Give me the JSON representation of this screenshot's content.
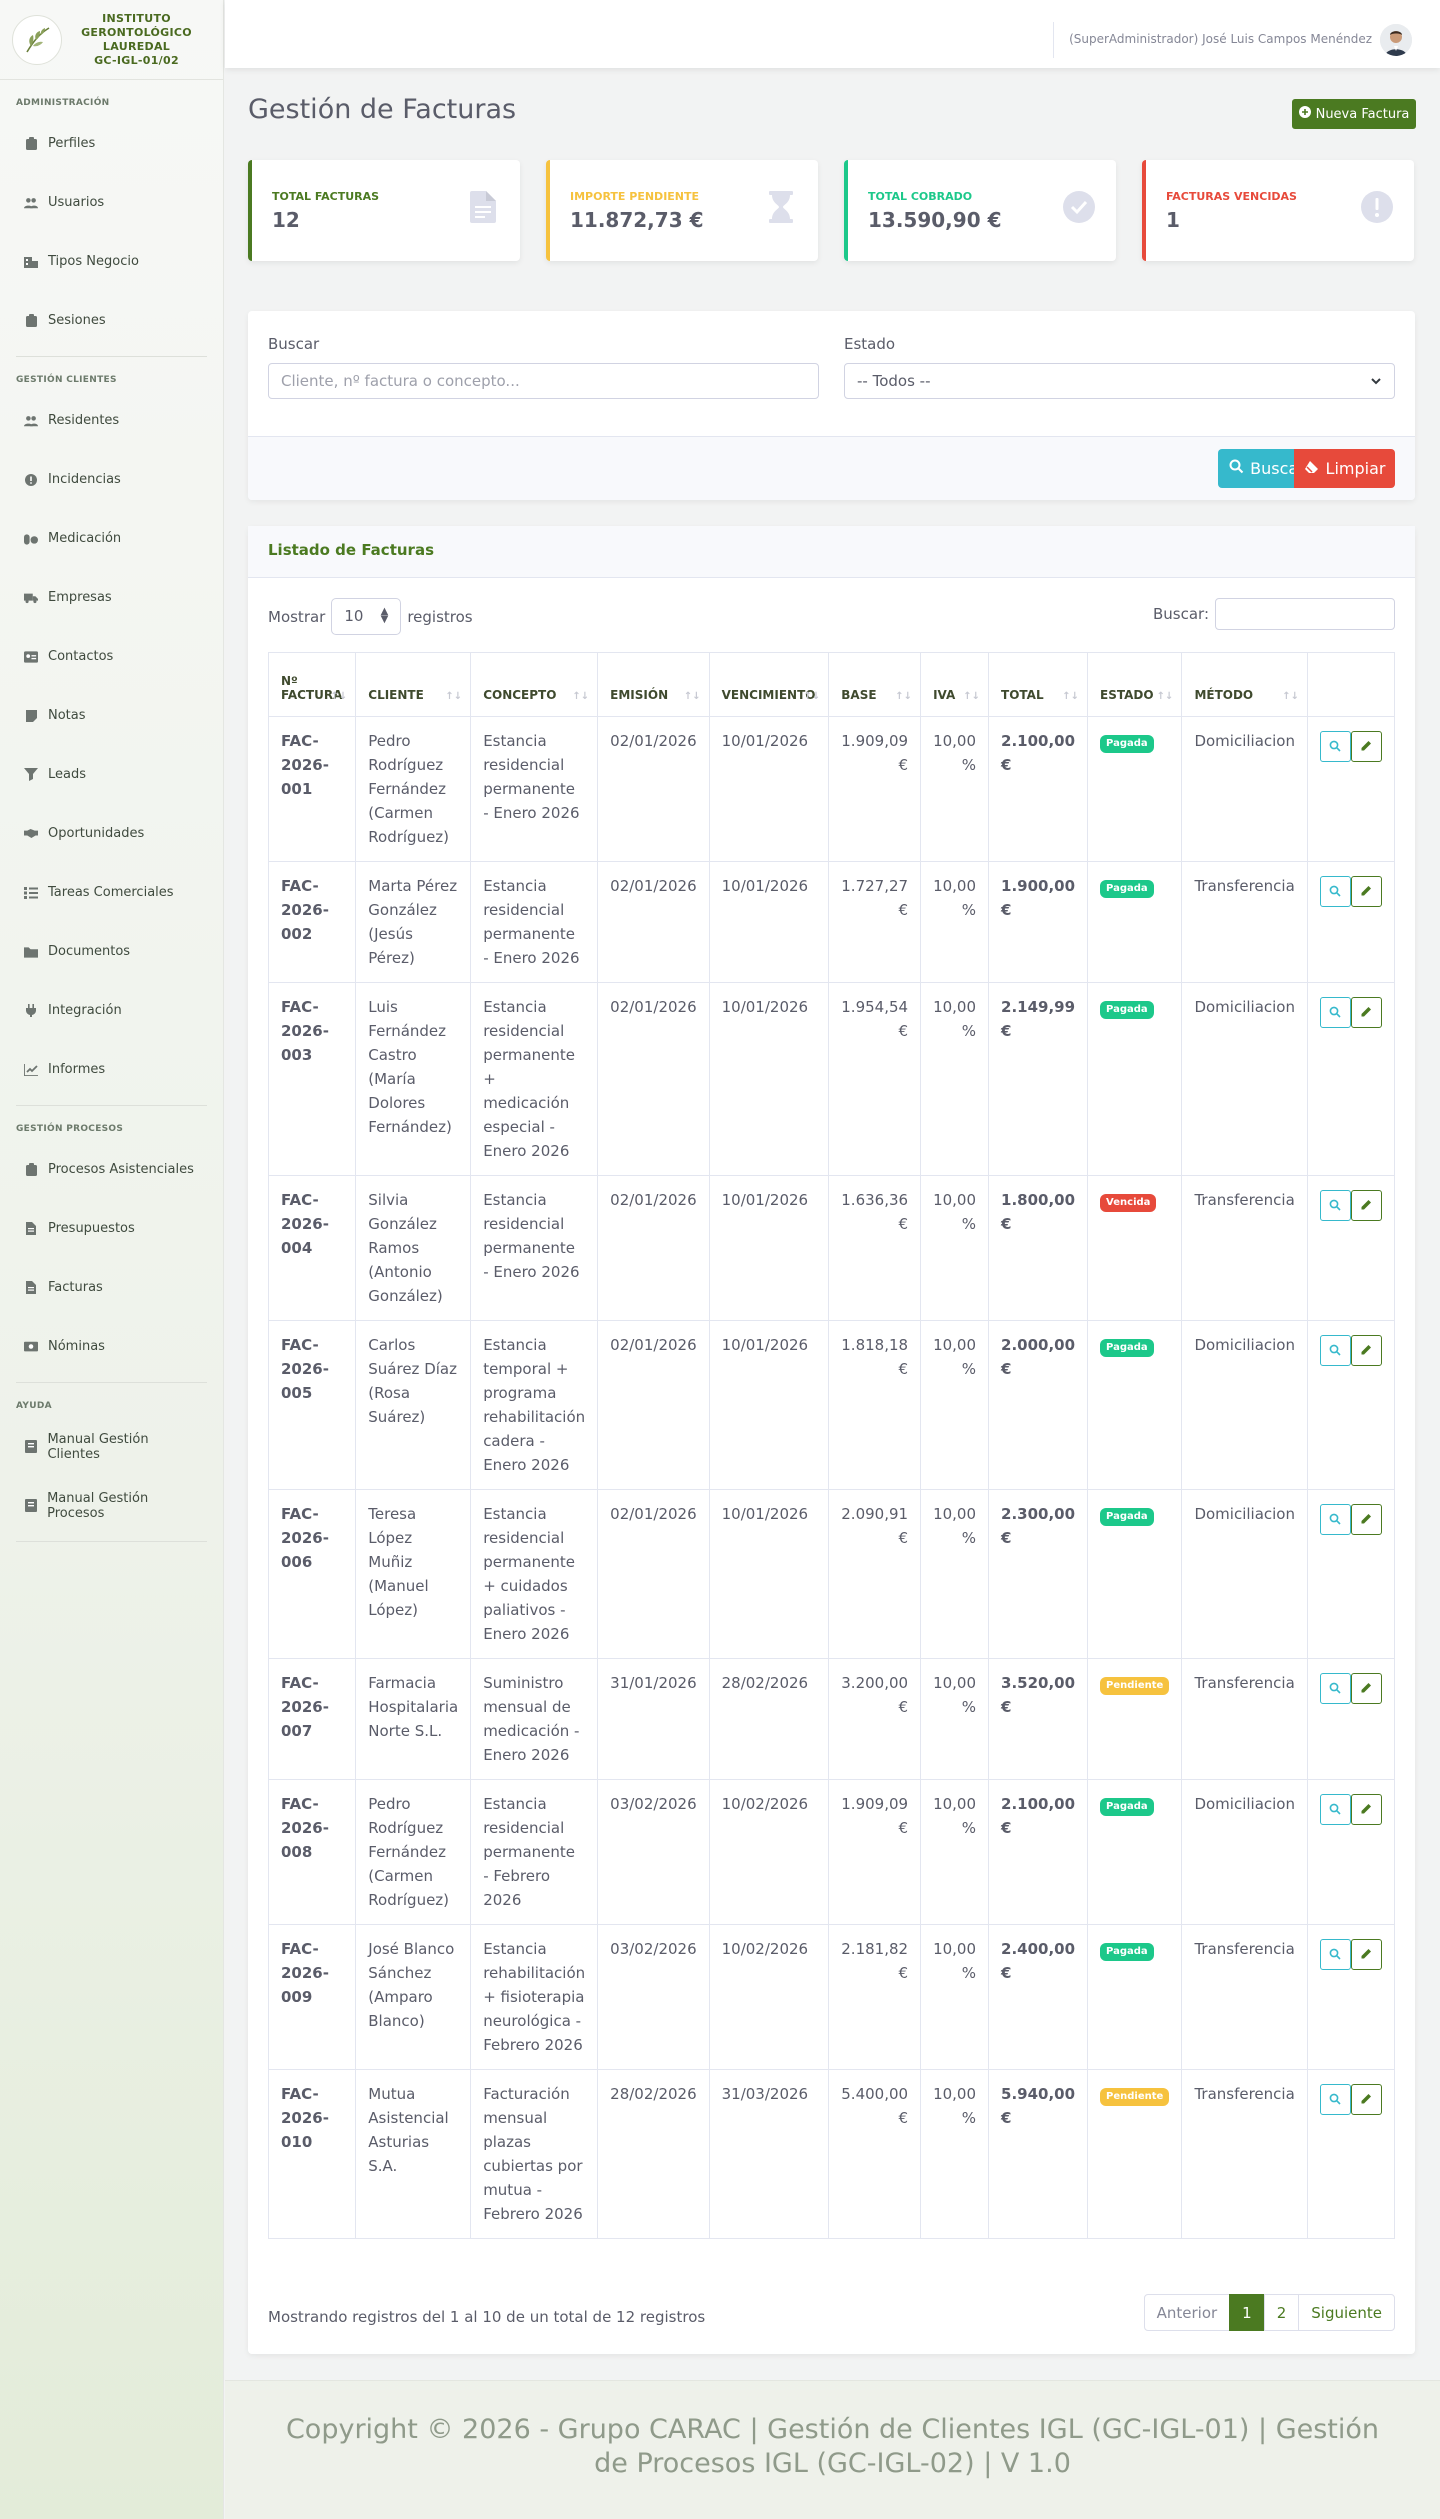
{
  "brand": {
    "line1": "INSTITUTO",
    "line2": "GERONTOLÓGICO",
    "line3": "LAUREDAL",
    "line4": "GC-IGL-01/02"
  },
  "sidebar": {
    "sections": [
      {
        "heading": "ADMINISTRACIÓN",
        "items": [
          {
            "label": "Perfiles",
            "icon": "clipboard-icon"
          },
          {
            "label": "Usuarios",
            "icon": "users-icon"
          },
          {
            "label": "Tipos Negocio",
            "icon": "building-icon"
          },
          {
            "label": "Sesiones",
            "icon": "clipboard-icon"
          }
        ]
      },
      {
        "heading": "GESTIÓN CLIENTES",
        "items": [
          {
            "label": "Residentes",
            "icon": "users-icon"
          },
          {
            "label": "Incidencias",
            "icon": "alert-icon"
          },
          {
            "label": "Medicación",
            "icon": "pills-icon"
          },
          {
            "label": "Empresas",
            "icon": "truck-icon"
          },
          {
            "label": "Contactos",
            "icon": "id-card-icon"
          },
          {
            "label": "Notas",
            "icon": "note-icon"
          },
          {
            "label": "Leads",
            "icon": "funnel-icon"
          },
          {
            "label": "Oportunidades",
            "icon": "handshake-icon"
          },
          {
            "label": "Tareas Comerciales",
            "icon": "tasks-icon"
          },
          {
            "label": "Documentos",
            "icon": "folder-icon"
          },
          {
            "label": "Integración",
            "icon": "plug-icon"
          },
          {
            "label": "Informes",
            "icon": "chart-icon"
          }
        ]
      },
      {
        "heading": "GESTIÓN PROCESOS",
        "items": [
          {
            "label": "Procesos Asistenciales",
            "icon": "clipboard-icon"
          },
          {
            "label": "Presupuestos",
            "icon": "file-icon"
          },
          {
            "label": "Facturas",
            "icon": "file-icon"
          },
          {
            "label": "Nóminas",
            "icon": "money-icon"
          }
        ]
      },
      {
        "heading": "AYUDA",
        "items": [
          {
            "label": "Manual Gestión Clientes",
            "icon": "book-icon"
          },
          {
            "label": "Manual Gestión Procesos",
            "icon": "book-icon"
          }
        ]
      }
    ]
  },
  "topbar": {
    "user": "(SuperAdministrador) José Luis Campos Menéndez"
  },
  "page": {
    "title": "Gestión de Facturas",
    "new_button": "Nueva Factura"
  },
  "cards": [
    {
      "label": "TOTAL FACTURAS",
      "value": "12",
      "color": "#4b7a21",
      "icon": "file-invoice-icon"
    },
    {
      "label": "IMPORTE PENDIENTE",
      "value": "11.872,73 €",
      "color": "#f6c23e",
      "icon": "hourglass-icon"
    },
    {
      "label": "TOTAL COBRADO",
      "value": "13.590,90 €",
      "color": "#1cc88a",
      "icon": "check-circle-icon"
    },
    {
      "label": "FACTURAS VENCIDAS",
      "value": "1",
      "color": "#e74a3b",
      "icon": "exclamation-circle-icon"
    }
  ],
  "filters": {
    "search_label": "Buscar",
    "search_placeholder": "Cliente, nº factura o concepto...",
    "status_label": "Estado",
    "status_value": "-- Todos --",
    "search_button": "Buscar",
    "clear_button": "Limpiar"
  },
  "list": {
    "title": "Listado de Facturas",
    "show_label": "Mostrar",
    "show_value": "10",
    "records_label": "registros",
    "search_label": "Buscar:",
    "columns": [
      "Nº FACTURA",
      "CLIENTE",
      "CONCEPTO",
      "EMISIÓN",
      "VENCIMIENTO",
      "BASE",
      "IVA",
      "TOTAL",
      "ESTADO",
      "MÉTODO"
    ],
    "rows": [
      {
        "num": "FAC-2026-001",
        "client": "Pedro Rodríguez Fernández (Carmen Rodríguez)",
        "concept": "Estancia residencial permanente - Enero 2026",
        "issue": "02/01/2026",
        "due": "10/01/2026",
        "base": "1.909,09 €",
        "iva": "10,00 %",
        "total": "2.100,00 €",
        "status": "Pagada",
        "method": "Domiciliacion"
      },
      {
        "num": "FAC-2026-002",
        "client": "Marta Pérez González (Jesús Pérez)",
        "concept": "Estancia residencial permanente - Enero 2026",
        "issue": "02/01/2026",
        "due": "10/01/2026",
        "base": "1.727,27 €",
        "iva": "10,00 %",
        "total": "1.900,00 €",
        "status": "Pagada",
        "method": "Transferencia"
      },
      {
        "num": "FAC-2026-003",
        "client": "Luis Fernández Castro (María Dolores Fernández)",
        "concept": "Estancia residencial permanente + medicación especial - Enero 2026",
        "issue": "02/01/2026",
        "due": "10/01/2026",
        "base": "1.954,54 €",
        "iva": "10,00 %",
        "total": "2.149,99 €",
        "status": "Pagada",
        "method": "Domiciliacion"
      },
      {
        "num": "FAC-2026-004",
        "client": "Silvia González Ramos (Antonio González)",
        "concept": "Estancia residencial permanente - Enero 2026",
        "issue": "02/01/2026",
        "due": "10/01/2026",
        "base": "1.636,36 €",
        "iva": "10,00 %",
        "total": "1.800,00 €",
        "status": "Vencida",
        "method": "Transferencia"
      },
      {
        "num": "FAC-2026-005",
        "client": "Carlos Suárez Díaz (Rosa Suárez)",
        "concept": "Estancia temporal + programa rehabilitación cadera - Enero 2026",
        "issue": "02/01/2026",
        "due": "10/01/2026",
        "base": "1.818,18 €",
        "iva": "10,00 %",
        "total": "2.000,00 €",
        "status": "Pagada",
        "method": "Domiciliacion"
      },
      {
        "num": "FAC-2026-006",
        "client": "Teresa López Muñiz (Manuel López)",
        "concept": "Estancia residencial permanente + cuidados paliativos - Enero 2026",
        "issue": "02/01/2026",
        "due": "10/01/2026",
        "base": "2.090,91 €",
        "iva": "10,00 %",
        "total": "2.300,00 €",
        "status": "Pagada",
        "method": "Domiciliacion"
      },
      {
        "num": "FAC-2026-007",
        "client": "Farmacia Hospitalaria Norte S.L.",
        "concept": "Suministro mensual de medicación - Enero 2026",
        "issue": "31/01/2026",
        "due": "28/02/2026",
        "base": "3.200,00 €",
        "iva": "10,00 %",
        "total": "3.520,00 €",
        "status": "Pendiente",
        "method": "Transferencia"
      },
      {
        "num": "FAC-2026-008",
        "client": "Pedro Rodríguez Fernández (Carmen Rodríguez)",
        "concept": "Estancia residencial permanente - Febrero 2026",
        "issue": "03/02/2026",
        "due": "10/02/2026",
        "base": "1.909,09 €",
        "iva": "10,00 %",
        "total": "2.100,00 €",
        "status": "Pagada",
        "method": "Domiciliacion"
      },
      {
        "num": "FAC-2026-009",
        "client": "José Blanco Sánchez (Amparo Blanco)",
        "concept": "Estancia rehabilitación + fisioterapia neurológica - Febrero 2026",
        "issue": "03/02/2026",
        "due": "10/02/2026",
        "base": "2.181,82 €",
        "iva": "10,00 %",
        "total": "2.400,00 €",
        "status": "Pagada",
        "method": "Transferencia"
      },
      {
        "num": "FAC-2026-010",
        "client": "Mutua Asistencial Asturias S.A.",
        "concept": "Facturación mensual plazas cubiertas por mutua - Febrero 2026",
        "issue": "28/02/2026",
        "due": "31/03/2026",
        "base": "5.400,00 €",
        "iva": "10,00 %",
        "total": "5.940,00 €",
        "status": "Pendiente",
        "method": "Transferencia"
      }
    ],
    "status_colors": {
      "Pagada": "#1cc88a",
      "Vencida": "#e74a3b",
      "Pendiente": "#f6c23e"
    },
    "info": "Mostrando registros del 1 al 10 de un total de 12 registros",
    "pager": {
      "prev": "Anterior",
      "pages": [
        "1",
        "2"
      ],
      "active": "1",
      "next": "Siguiente"
    }
  },
  "footer": {
    "text": "Copyright © 2026 - Grupo CARAC | Gestión de Clientes IGL (GC-IGL-01) | Gestión de Procesos IGL (GC-IGL-02) | V 1.0"
  }
}
